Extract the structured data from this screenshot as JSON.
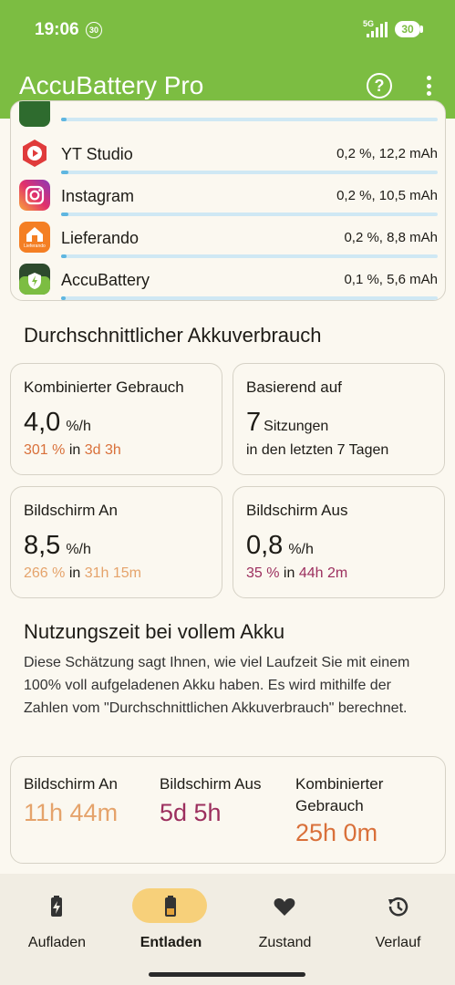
{
  "status_bar": {
    "time": "19:06",
    "notification_badge": "30",
    "network": "5G",
    "battery": "30"
  },
  "header": {
    "title": "AccuBattery Pro",
    "help_icon": "help-circle-icon",
    "more_icon": "more-vert-icon"
  },
  "app_list": {
    "items": [
      {
        "name": "YT Studio",
        "usage": "0,2 %, 12,2 mAh",
        "bar_fraction": 0.02,
        "icon": "yt-studio-icon"
      },
      {
        "name": "Instagram",
        "usage": "0,2 %, 10,5 mAh",
        "bar_fraction": 0.02,
        "icon": "instagram-icon"
      },
      {
        "name": "Lieferando",
        "usage": "0,2 %, 8,8 mAh",
        "bar_fraction": 0.015,
        "icon": "lieferando-icon",
        "icon_text": "Lieferando"
      },
      {
        "name": "AccuBattery",
        "usage": "0,1 %, 5,6 mAh",
        "bar_fraction": 0.012,
        "icon": "accubattery-icon"
      }
    ]
  },
  "avg_usage": {
    "title": "Durchschnittlicher Akkuverbrauch",
    "combined": {
      "label": "Kombinierter Gebrauch",
      "value": "4,0",
      "unit": "%/h",
      "pct": "301 %",
      "in": "in",
      "duration": "3d 3h"
    },
    "based_on": {
      "label": "Basierend auf",
      "value": "7",
      "unit": "Sitzungen",
      "detail": "in den letzten 7 Tagen"
    },
    "screen_on": {
      "label": "Bildschirm An",
      "value": "8,5",
      "unit": "%/h",
      "pct": "266 %",
      "in": "in",
      "duration": "31h 15m"
    },
    "screen_off": {
      "label": "Bildschirm Aus",
      "value": "0,8",
      "unit": "%/h",
      "pct": "35 %",
      "in": "in",
      "duration": "44h 2m"
    }
  },
  "full_battery": {
    "title": "Nutzungszeit bei vollem Akku",
    "description": "Diese Schätzung sagt Ihnen, wie viel Laufzeit Sie mit einem 100% voll aufgeladenen Akku haben. Es wird mithilfe der Zahlen vom \"Durchschnittlichen Akkuverbrauch\" berechnet.",
    "screen_on": {
      "label": "Bildschirm An",
      "value": "11h 44m"
    },
    "screen_off": {
      "label": "Bildschirm Aus",
      "value": "5d 5h"
    },
    "combined": {
      "label_line1": "Kombinierter",
      "label_line2": "Gebrauch",
      "value": "25h 0m"
    }
  },
  "bottom_nav": {
    "items": [
      {
        "label": "Aufladen",
        "icon": "battery-charging-icon",
        "selected": false
      },
      {
        "label": "Entladen",
        "icon": "battery-discharging-icon",
        "selected": true
      },
      {
        "label": "Zustand",
        "icon": "heart-icon",
        "selected": false
      },
      {
        "label": "Verlauf",
        "icon": "history-icon",
        "selected": false
      }
    ]
  },
  "colors": {
    "header": "#7cbd42",
    "combined": "#d9703a",
    "screen_on": "#e5a36b",
    "screen_off": "#9c2f5e",
    "usage_bar": "#5fb6e0",
    "nav_pill": "#f7d07a"
  }
}
